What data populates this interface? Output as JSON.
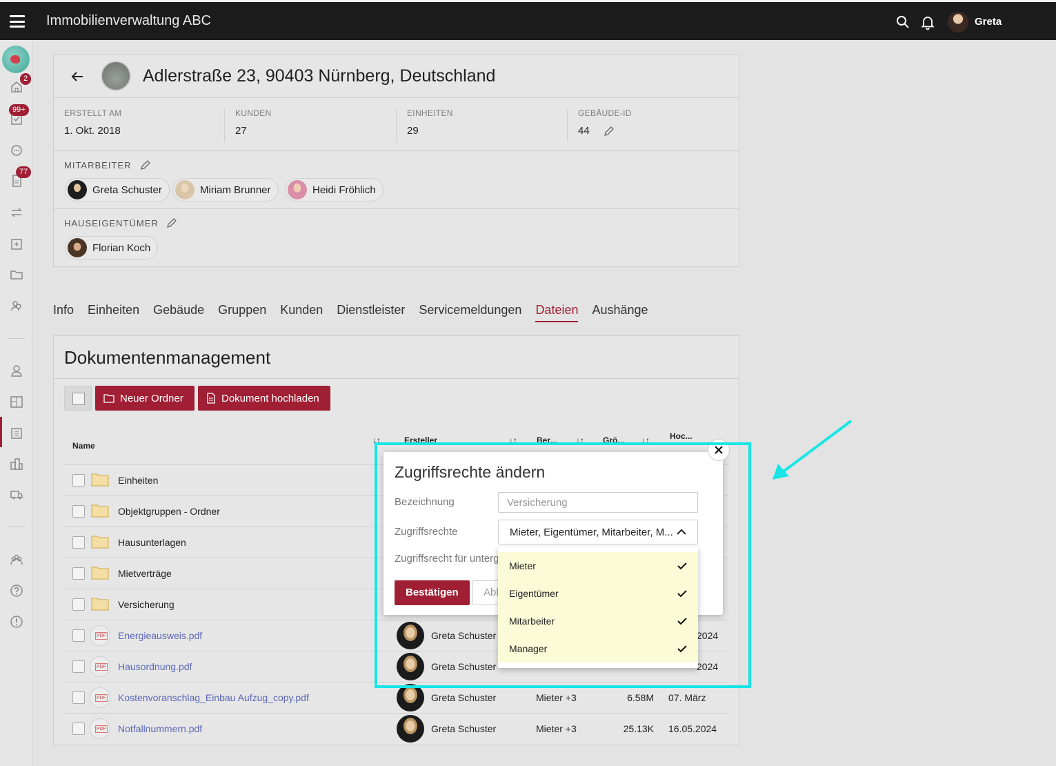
{
  "app": {
    "title": "Immobilienverwaltung ABC",
    "user": "Greta"
  },
  "sidebar": {
    "badges": {
      "home": "2",
      "tasks": "99+",
      "documents": "77"
    }
  },
  "building": {
    "title": "Adlerstraße 23, 90403 Nürnberg, Deutschland",
    "meta": [
      {
        "label": "ERSTELLT AM",
        "value": "1. Okt. 2018"
      },
      {
        "label": "KUNDEN",
        "value": "27"
      },
      {
        "label": "EINHEITEN",
        "value": "29"
      },
      {
        "label": "GEBÄUDE-ID",
        "value": "44"
      }
    ],
    "employees_label": "MITARBEITER",
    "employees": [
      "Greta Schuster",
      "Miriam Brunner",
      "Heidi Fröhlich"
    ],
    "owners_label": "HAUSEIGENTÜMER",
    "owners": [
      "Florian Koch"
    ]
  },
  "tabs": [
    "Info",
    "Einheiten",
    "Gebäude",
    "Gruppen",
    "Kunden",
    "Dienstleister",
    "Servicemeldungen",
    "Dateien",
    "Aushänge"
  ],
  "docs": {
    "title": "Dokumentenmanagement",
    "new_folder": "Neuer Ordner",
    "upload": "Dokument hochladen",
    "columns": {
      "name": "Name",
      "creator": "Ersteller",
      "perm": "Ber...",
      "size": "Grö...",
      "upload": "Hoc..."
    },
    "rows": [
      {
        "name": "Einheiten",
        "type": "folder"
      },
      {
        "name": "Objektgruppen - Ordner",
        "type": "folder"
      },
      {
        "name": "Hausunterlagen",
        "type": "folder"
      },
      {
        "name": "Mietverträge",
        "type": "folder"
      },
      {
        "name": "Versicherung",
        "type": "folder"
      },
      {
        "name": "Energieausweis.pdf",
        "type": "pdf",
        "creator": "Greta Schuster",
        "perm": "",
        "size": "",
        "date": "2024"
      },
      {
        "name": "Hausordnung.pdf",
        "type": "pdf",
        "creator": "Greta Schuster",
        "perm": "",
        "size": "",
        "date": "2024"
      },
      {
        "name": "Kostenvoranschlag_Einbau Aufzug_copy.pdf",
        "type": "pdf",
        "creator": "Greta Schuster",
        "perm": "Mieter +3",
        "size": "6.58M",
        "date": "07. März"
      },
      {
        "name": "Notfallnummern.pdf",
        "type": "pdf",
        "creator": "Greta Schuster",
        "perm": "Mieter +3",
        "size": "25.13K",
        "date": "16.05.2024"
      }
    ]
  },
  "dialog": {
    "title": "Zugriffsrechte ändern",
    "label_name": "Bezeichnung",
    "name_placeholder": "Versicherung",
    "label_rights": "Zugriffsrechte",
    "rights_value": "Mieter, Eigentümer, Mitarbeiter, M...",
    "label_sub": "Zugriffsrecht für unterg",
    "confirm": "Bestätigen",
    "cancel": "Abbrechen",
    "options": [
      "Mieter",
      "Eigentümer",
      "Mitarbeiter",
      "Manager"
    ]
  },
  "colors": {
    "accent": "#a01f34",
    "highlight": "#18e6e6",
    "option_bg": "#fbfbd8"
  }
}
